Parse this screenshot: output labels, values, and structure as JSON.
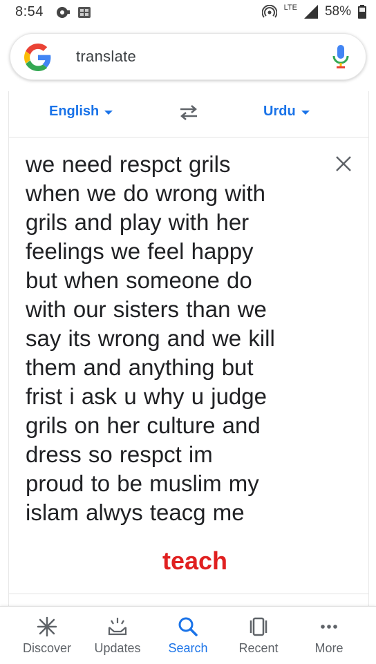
{
  "status_bar": {
    "time": "8:54",
    "network": "LTE",
    "battery": "58%"
  },
  "search": {
    "query": "translate",
    "icons": [
      "google-logo",
      "mic-icon"
    ]
  },
  "translate": {
    "source_language": "English",
    "target_language": "Urdu",
    "source_text": "we need respct grils\nwhen we do wrong with\ngrils and play with her\nfeelings we feel happy\nbut when someone do\nwith our sisters than we\nsay its wrong and we kill\nthem and anything but\nfrist i ask u why u judge\ngrils on her culture and\ndress so respct im\nproud to be muslim my\nislam alwys teacg me",
    "overlay_annotation": "teach"
  },
  "bottom_nav": {
    "items": [
      {
        "label": "Discover",
        "icon": "discover-icon"
      },
      {
        "label": "Updates",
        "icon": "updates-icon"
      },
      {
        "label": "Search",
        "icon": "search-icon"
      },
      {
        "label": "Recent",
        "icon": "recent-icon"
      },
      {
        "label": "More",
        "icon": "more-icon"
      }
    ]
  },
  "colors": {
    "accent": "#1a73e8",
    "overlay_red": "#e02020",
    "text": "#202124",
    "muted": "#5f6368"
  }
}
